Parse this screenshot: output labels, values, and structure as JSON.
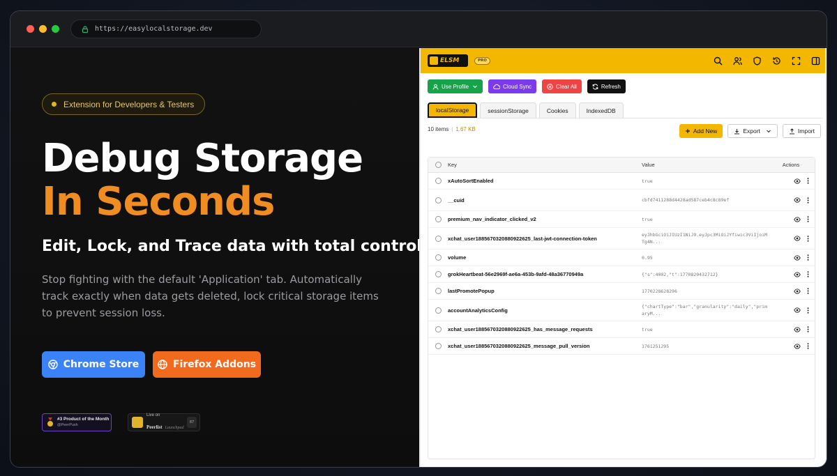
{
  "browser": {
    "url": "https://easylocalstorage.dev"
  },
  "hero": {
    "pill": "Extension for Developers & Testers",
    "headline_line1": "Debug Storage",
    "headline_line2": "In Seconds",
    "subheadline": "Edit, Lock, and Trace data with total control.",
    "description": "Stop fighting with the default 'Application' tab. Automatically track exactly when data gets deleted, lock critical storage items to prevent session loss.",
    "chrome_button": "Chrome Store",
    "firefox_button": "Firefox Addons",
    "badge_peerpush": {
      "title": "#3 Product of the Month",
      "by": "@PeerPush"
    },
    "badge_peerlist": {
      "line1": "Live on",
      "line2": "Peerlist",
      "suffix": "Launchpad",
      "count": "87"
    }
  },
  "panel": {
    "logo": "ELSM",
    "pro_badge": "PRO",
    "header_icons": [
      "search-icon",
      "users-icon",
      "shield-icon",
      "history-icon",
      "expand-icon",
      "sidebar-icon"
    ],
    "toolbar": {
      "use_profile": "Use Profile",
      "cloud_sync": "Cloud Sync",
      "clear_all": "Clear All",
      "refresh": "Refresh"
    },
    "tabs": [
      "localStorage",
      "sessionStorage",
      "Cookies",
      "IndexedDB"
    ],
    "active_tab": "localStorage",
    "meta": {
      "items": "10 items",
      "size": "1.67 KB"
    },
    "actions": {
      "add_new": "Add New",
      "export": "Export",
      "import": "Import"
    },
    "table": {
      "headers": {
        "key": "Key",
        "value": "Value",
        "actions": "Actions"
      },
      "rows": [
        {
          "key": "xAutoSortEnabled",
          "value": "true"
        },
        {
          "key": "__cuid",
          "value": "cbfd7411288d4428ad587ceb4c8c89ef"
        },
        {
          "key": "premium_nav_indicator_clicked_v2",
          "value": "true"
        },
        {
          "key": "xchat_user1885670320880922625_last-jwt-connection-token",
          "value": "eyJhbGciOiJIUzI1NiJ9.eyJpc3MiOiJYfiwic3ViIjoiMTg4N..."
        },
        {
          "key": "volume",
          "value": "0.95"
        },
        {
          "key": "grokHeartbeat-56e2969f-ae6a-453b-9afd-48a36770949a",
          "value": "{\"s\":4002,\"t\":1770820432712}"
        },
        {
          "key": "lastPromotePopup",
          "value": "1770228628296"
        },
        {
          "key": "accountAnalyticsConfig",
          "value": "{\"chartType\":\"bar\",\"granularity\":\"daily\",\"primaryM..."
        },
        {
          "key": "xchat_user1885670320880922625_has_message_requests",
          "value": "true"
        },
        {
          "key": "xchat_user1885670320880922625_message_pull_version",
          "value": "1761251295"
        }
      ]
    }
  },
  "colors": {
    "accent_yellow": "#f3b700",
    "headline_orange": "#ef8c22",
    "chrome_blue": "#3b82f6",
    "firefox_orange": "#f26a1d"
  }
}
